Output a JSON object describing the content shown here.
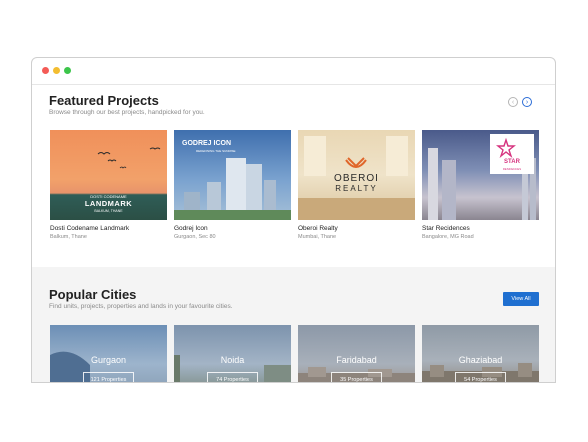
{
  "featured": {
    "title": "Featured Projects",
    "subtitle": "Browse through our best projects, handpicked for you.",
    "projects": [
      {
        "name": "Dosti Codename Landmark",
        "location": "Balkum, Thane",
        "logo_line1": "DOSTI CODENAME",
        "logo_line2": "LANDMARK",
        "logo_line3": "BALKUM, THANE"
      },
      {
        "name": "Godrej Icon",
        "location": "Gurgaon, Sec 80",
        "logo_line1": "GODREJ ICON",
        "logo_line2": "REDEFINING THE SUNRISE"
      },
      {
        "name": "Oberoi Realty",
        "location": "Mumbai, Thane",
        "logo_line1": "OBEROI",
        "logo_line2": "REALTY"
      },
      {
        "name": "Star Recidences",
        "location": "Bangalore, MG Road",
        "logo_line1": "STAR",
        "logo_line2": "RESIDENCES"
      }
    ]
  },
  "popular": {
    "title": "Popular Cities",
    "subtitle": "Find units, projects, properties and lands in your favourite cities.",
    "view_all": "View All",
    "cities": [
      {
        "name": "Gurgaon",
        "properties": "121 Properties"
      },
      {
        "name": "Noida",
        "properties": "74 Properties"
      },
      {
        "name": "Faridabad",
        "properties": "35 Properties"
      },
      {
        "name": "Ghaziabad",
        "properties": "54 Properties"
      }
    ]
  },
  "colors": {
    "accent": "#1f6fd0",
    "section_bg": "#f4f4f4"
  },
  "icons": {
    "prev": "chevron-left-icon",
    "next": "chevron-right-icon"
  }
}
